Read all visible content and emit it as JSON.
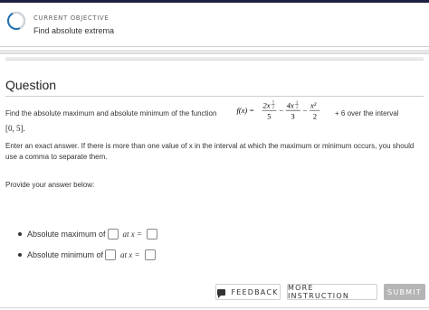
{
  "objective": {
    "label": "CURRENT OBJECTIVE",
    "title": "Find absolute extrema"
  },
  "question": {
    "heading": "Question",
    "prompt_start": "Find the absolute maximum and absolute minimum of the function",
    "formula": {
      "lhs": "f(x) =",
      "term1_num": "2x",
      "term1_exp_num": "5",
      "term1_exp_den": "2",
      "term1_den": "5",
      "minus1": "−",
      "term2_num": "4x",
      "term2_exp_num": "3",
      "term2_exp_den": "2",
      "term2_den": "3",
      "minus2": "−",
      "term3_num": "x²",
      "term3_den": "2",
      "plus6": "+ 6"
    },
    "prompt_end": "over the interval",
    "interval": "[0, 5].",
    "instructions": "Enter an exact answer. If there is more than one value of x in the interval at which the maximum or minimum occurs, you should use a comma to separate them.",
    "provide": "Provide your answer below:"
  },
  "answers": [
    {
      "label": "Absolute maximum of",
      "at_text": "at x ="
    },
    {
      "label": "Absolute minimum of",
      "at_text": "at x ="
    }
  ],
  "buttons": {
    "feedback": "FEEDBACK",
    "more_instruction": "MORE INSTRUCTION",
    "submit": "SUBMIT"
  }
}
